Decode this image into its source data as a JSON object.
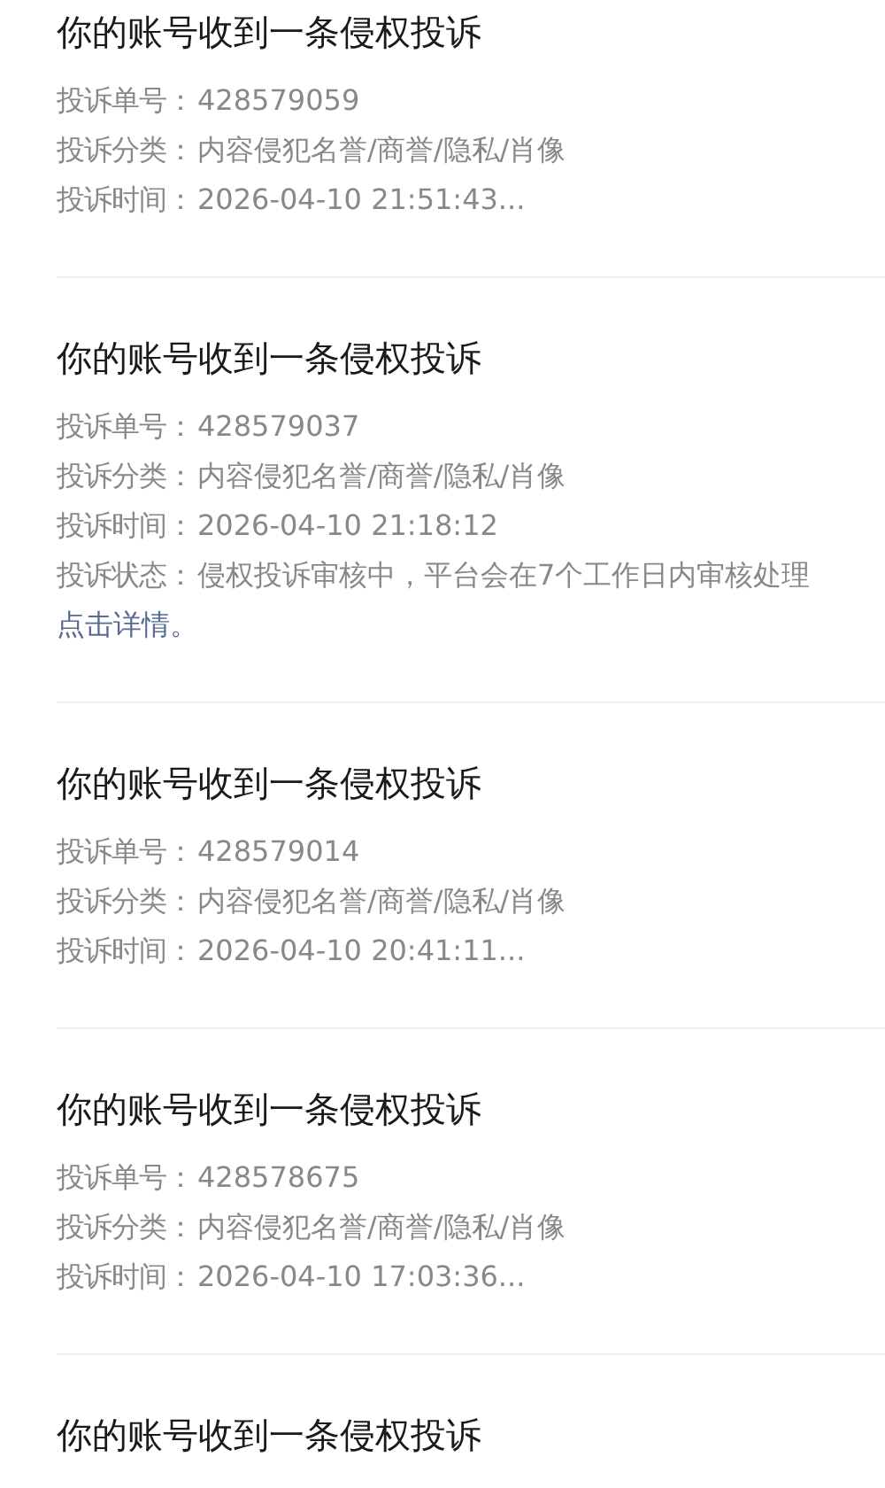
{
  "notifications": [
    {
      "title": "你的账号收到一条侵权投诉",
      "fields": [
        {
          "label": "投诉单号：",
          "value": "428579059"
        },
        {
          "label": "投诉分类：",
          "value": "内容侵犯名誉/商誉/隐私/肖像"
        },
        {
          "label": "投诉时间：",
          "value": "2026-04-10 21:51:43..."
        }
      ]
    },
    {
      "title": "你的账号收到一条侵权投诉",
      "fields": [
        {
          "label": "投诉单号：",
          "value": "428579037"
        },
        {
          "label": "投诉分类：",
          "value": "内容侵犯名誉/商誉/隐私/肖像"
        },
        {
          "label": "投诉时间：",
          "value": "2026-04-10 21:18:12"
        },
        {
          "label": "投诉状态：",
          "value": "侵权投诉审核中，平台会在7个工作日内审核处理"
        }
      ],
      "link": "点击详情。"
    },
    {
      "title": "你的账号收到一条侵权投诉",
      "fields": [
        {
          "label": "投诉单号：",
          "value": "428579014"
        },
        {
          "label": "投诉分类：",
          "value": "内容侵犯名誉/商誉/隐私/肖像"
        },
        {
          "label": "投诉时间：",
          "value": "2026-04-10 20:41:11..."
        }
      ]
    },
    {
      "title": "你的账号收到一条侵权投诉",
      "fields": [
        {
          "label": "投诉单号：",
          "value": "428578675"
        },
        {
          "label": "投诉分类：",
          "value": "内容侵犯名誉/商誉/隐私/肖像"
        },
        {
          "label": "投诉时间：",
          "value": "2026-04-10 17:03:36..."
        }
      ]
    },
    {
      "title": "你的账号收到一条侵权投诉"
    }
  ]
}
